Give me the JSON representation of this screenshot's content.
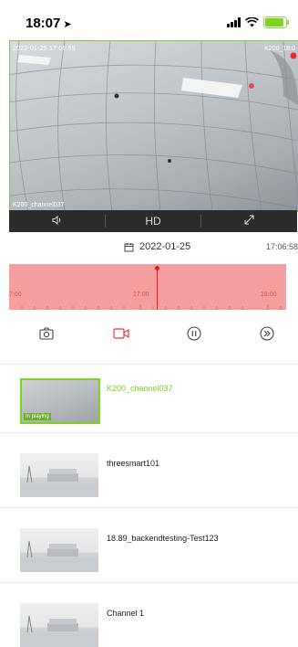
{
  "status_bar": {
    "time": "18:07",
    "location_icon": "location-arrow-icon",
    "signal": "cellular-signal-icon",
    "wifi": "wifi-icon",
    "battery": "battery-charging-icon"
  },
  "video": {
    "timestamp": "2022-01-25 17:06:59",
    "camera_label": "K200_18:0",
    "channel_label": "K200_channel037"
  },
  "video_controls": {
    "mute_icon": "speaker-icon",
    "quality": "HD",
    "fullscreen_icon": "expand-icon"
  },
  "date_row": {
    "calendar_icon": "calendar-icon",
    "date": "2022-01-25",
    "time": "17:06:58"
  },
  "timeline": {
    "labels": [
      "7:00",
      "17:00",
      "18:00"
    ],
    "accent": "#f59ea0",
    "cursor_color": "#e32020"
  },
  "actions": {
    "snapshot": "camera-icon",
    "record": "video-record-icon",
    "pause": "pause-icon",
    "playback": "play-forward-icon",
    "record_color": "#e23b3b"
  },
  "devices": [
    {
      "name": "K200_channel037",
      "tag": "In playing",
      "active": true
    },
    {
      "name": "threesmart101",
      "active": false
    },
    {
      "name": "18.89_backendtesting-Test123",
      "active": false
    },
    {
      "name": "Channel 1",
      "active": false
    }
  ],
  "colors": {
    "active_green": "#7ed321"
  }
}
